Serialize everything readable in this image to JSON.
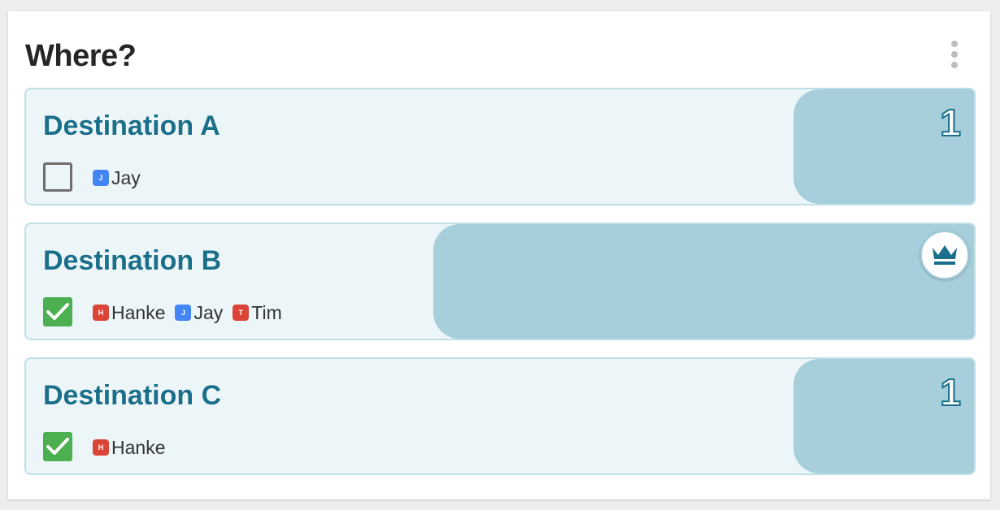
{
  "poll": {
    "title": "Where?",
    "menu_icon": "more-vertical-icon",
    "colors": {
      "accent": "#1a6f8a",
      "bar": "#a6cedb",
      "option_bg": "#ecf5f8",
      "check_green": "#4caf50",
      "avatar_blue": "#4285f4",
      "avatar_red": "#db4437"
    },
    "options": [
      {
        "name": "Destination A",
        "checked": false,
        "votes": 1,
        "vote_share": 0.33,
        "count_label": "1",
        "winner": false,
        "voters": [
          {
            "initial": "J",
            "name": "Jay",
            "color": "#4285f4"
          }
        ]
      },
      {
        "name": "Destination B",
        "checked": true,
        "votes": 3,
        "vote_share": 1.0,
        "winner": true,
        "winner_icon": "crown-icon",
        "voters": [
          {
            "initial": "H",
            "name": "Hanke",
            "color": "#db4437"
          },
          {
            "initial": "J",
            "name": "Jay",
            "color": "#4285f4"
          },
          {
            "initial": "T",
            "name": "Tim",
            "color": "#db4437"
          }
        ]
      },
      {
        "name": "Destination C",
        "checked": true,
        "votes": 1,
        "vote_share": 0.33,
        "count_label": "1",
        "winner": false,
        "voters": [
          {
            "initial": "H",
            "name": "Hanke",
            "color": "#db4437"
          }
        ]
      }
    ]
  }
}
